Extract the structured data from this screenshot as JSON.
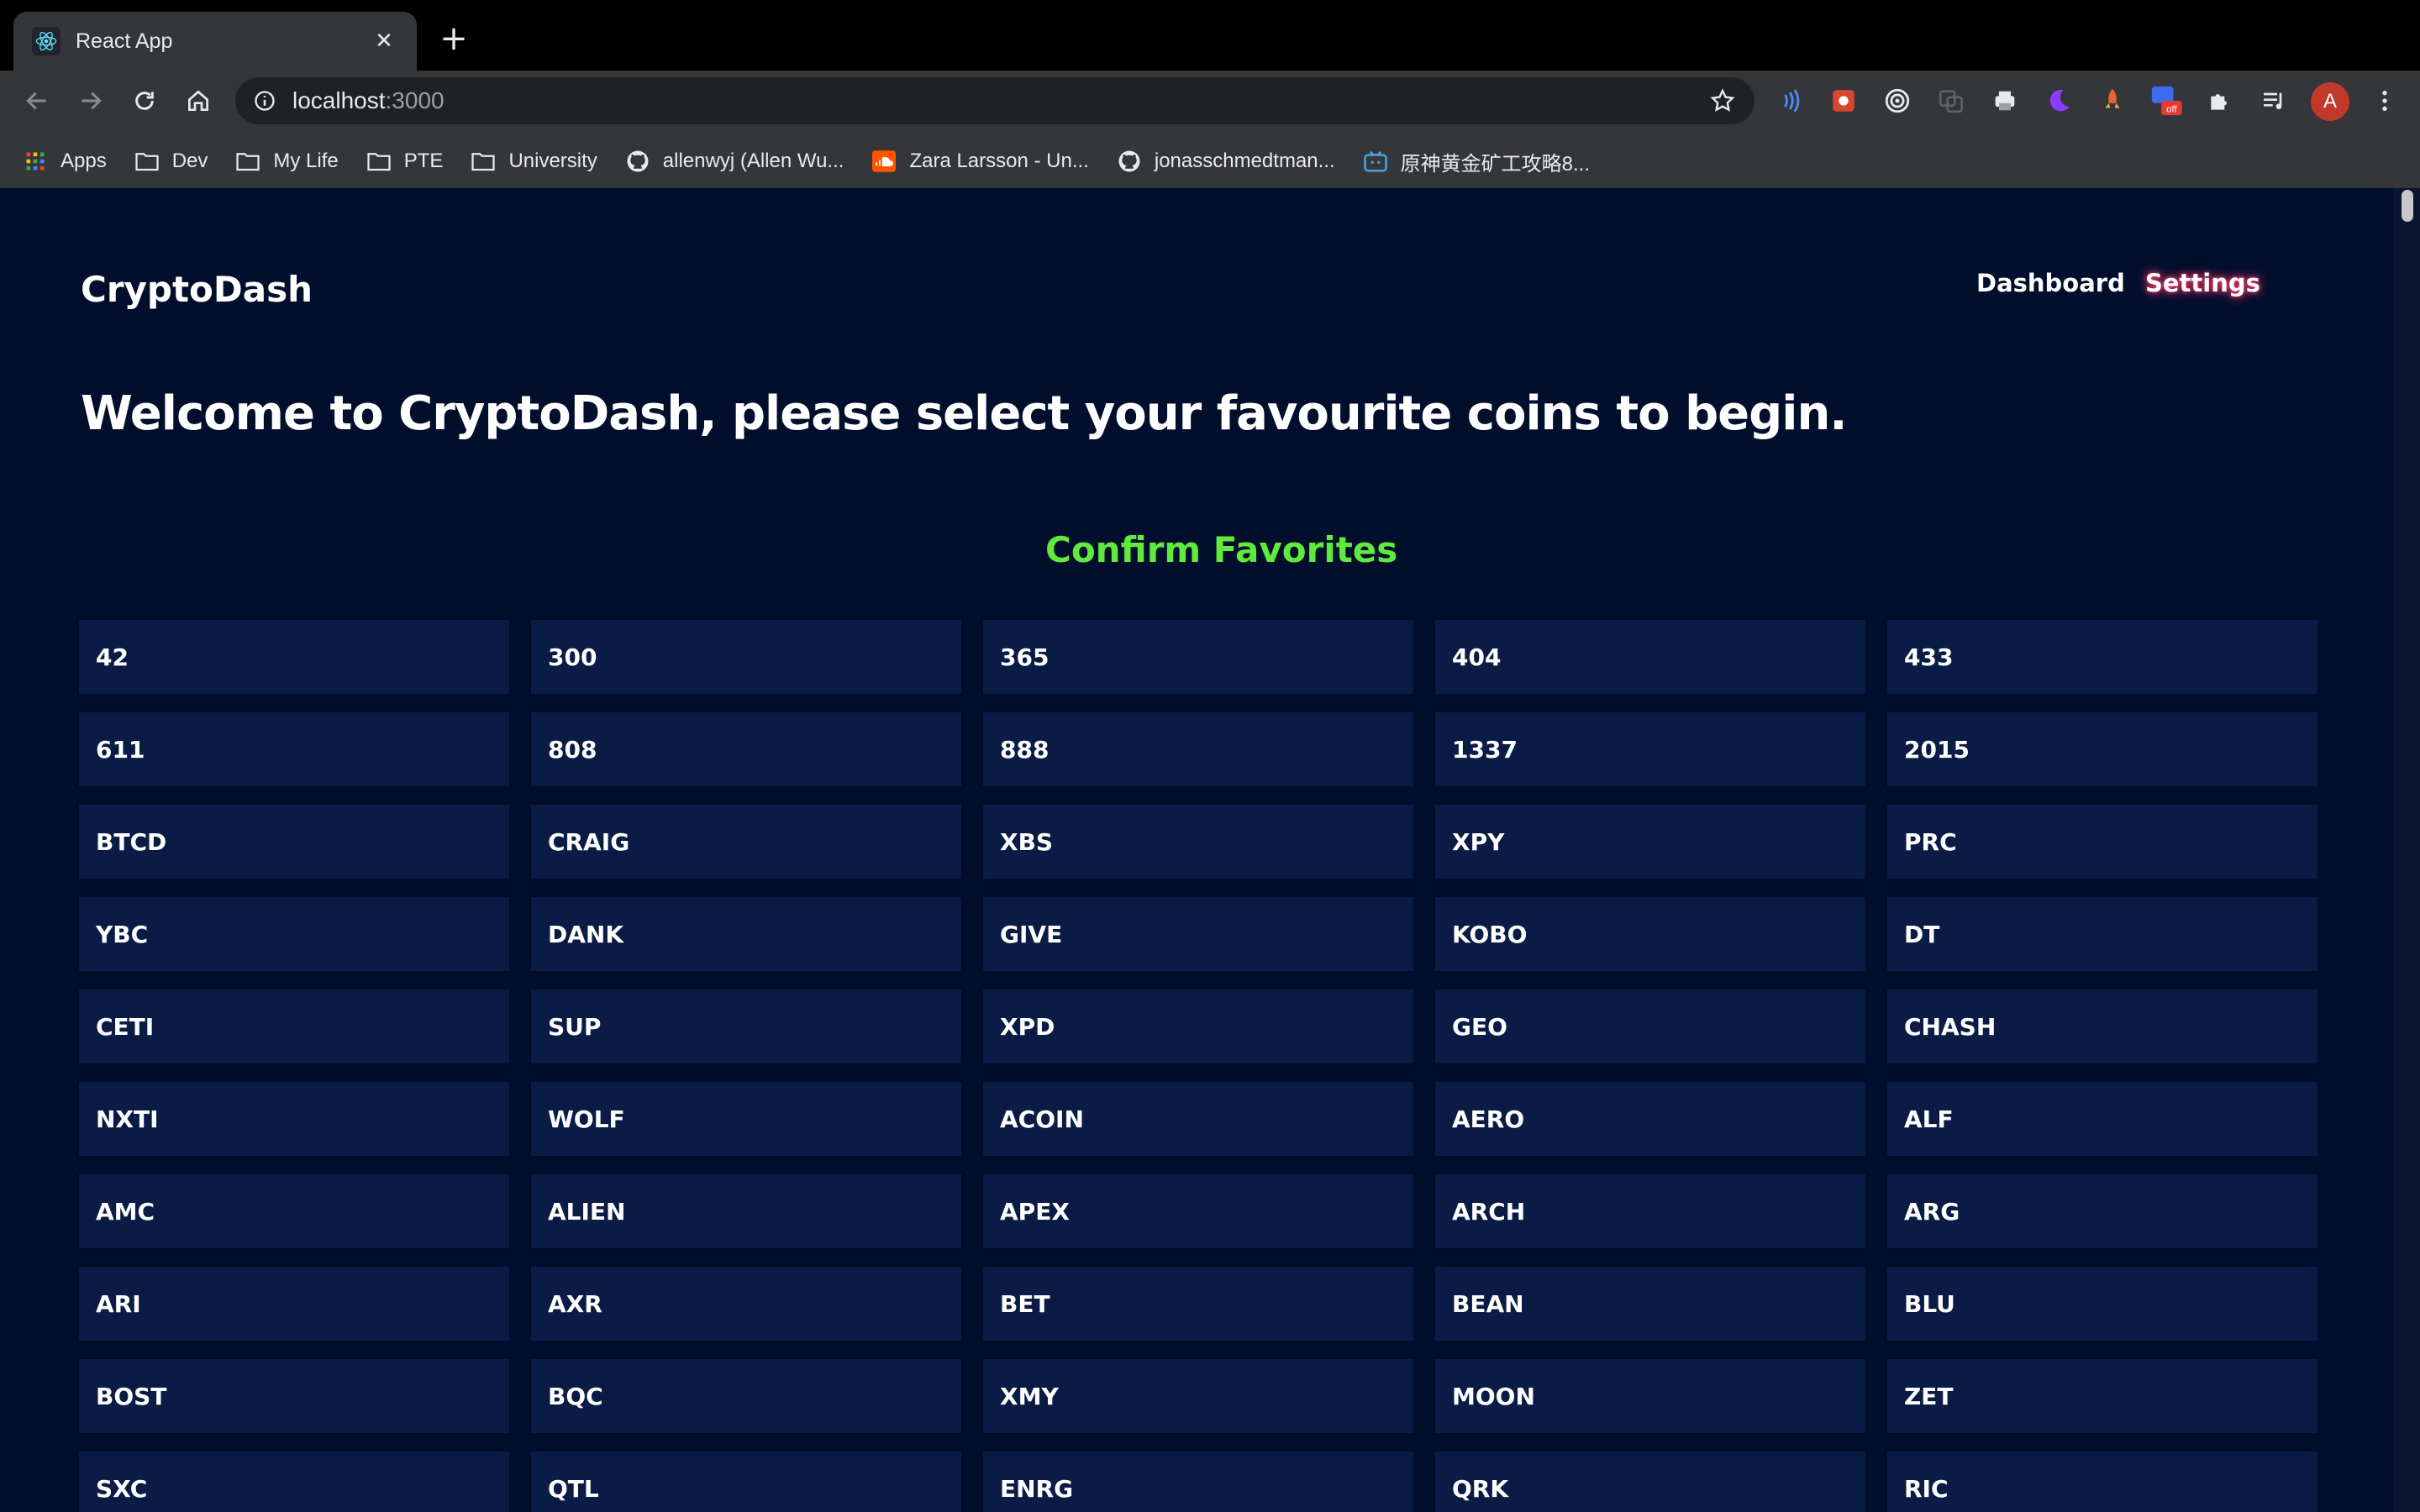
{
  "browser": {
    "tab_title": "React App",
    "url_host": "localhost",
    "url_port": ":3000",
    "avatar_letter": "A",
    "bookmarks": [
      {
        "label": "Apps",
        "icon": "apps-grid-icon"
      },
      {
        "label": "Dev",
        "icon": "folder-icon"
      },
      {
        "label": "My Life",
        "icon": "folder-icon"
      },
      {
        "label": "PTE",
        "icon": "folder-icon"
      },
      {
        "label": "University",
        "icon": "folder-icon"
      },
      {
        "label": "allenwyj (Allen Wu...",
        "icon": "github-icon"
      },
      {
        "label": "Zara Larsson - Un...",
        "icon": "soundcloud-icon"
      },
      {
        "label": "jonasschmedtman...",
        "icon": "github-icon"
      },
      {
        "label": "原神黄金矿工攻略8...",
        "icon": "bilibili-icon"
      }
    ]
  },
  "app": {
    "logo": "CryptoDash",
    "nav": {
      "dashboard": "Dashboard",
      "settings": "Settings"
    },
    "welcome": "Welcome to CryptoDash, please select your favourite coins to begin.",
    "confirm_label": "Confirm Favorites",
    "accent_color": "#5fea3d",
    "active_glow_color": "#ff3b6a",
    "coins": [
      "42",
      "300",
      "365",
      "404",
      "433",
      "611",
      "808",
      "888",
      "1337",
      "2015",
      "BTCD",
      "CRAIG",
      "XBS",
      "XPY",
      "PRC",
      "YBC",
      "DANK",
      "GIVE",
      "KOBO",
      "DT",
      "CETI",
      "SUP",
      "XPD",
      "GEO",
      "CHASH",
      "NXTI",
      "WOLF",
      "ACOIN",
      "AERO",
      "ALF",
      "AMC",
      "ALIEN",
      "APEX",
      "ARCH",
      "ARG",
      "ARI",
      "AXR",
      "BET",
      "BEAN",
      "BLU",
      "BOST",
      "BQC",
      "XMY",
      "MOON",
      "ZET",
      "SXC",
      "QTL",
      "ENRG",
      "QRK",
      "RIC"
    ]
  }
}
